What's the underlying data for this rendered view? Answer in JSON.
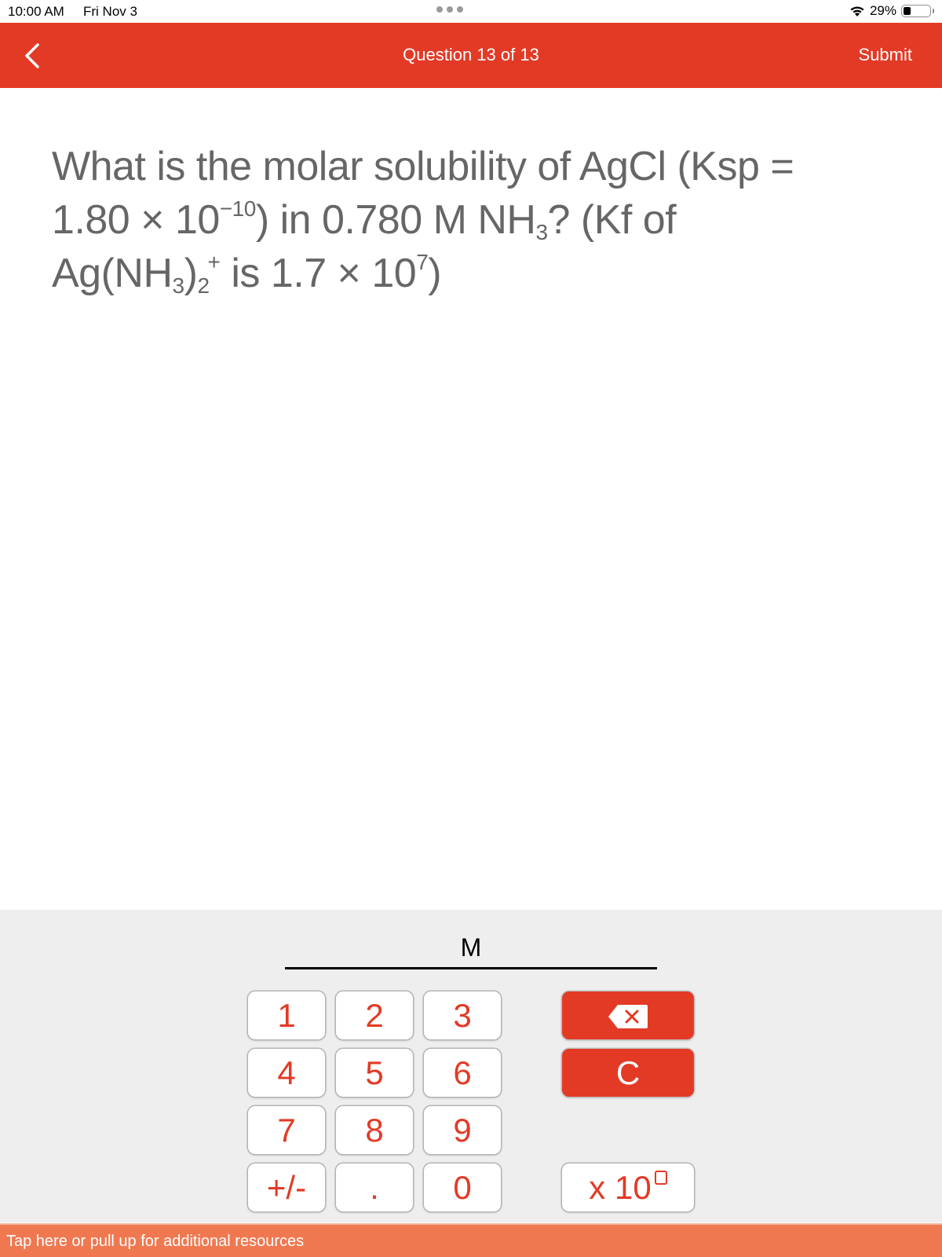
{
  "status_bar": {
    "time": "10:00 AM",
    "date": "Fri Nov 3",
    "battery_percent": "29%",
    "battery_level": 0.29,
    "icons": [
      "wifi-icon",
      "battery-icon",
      "multitask-dots-icon"
    ]
  },
  "nav": {
    "back_icon": "chevron-left-icon",
    "title": "Question 13 of 13",
    "submit_label": "Submit"
  },
  "question": {
    "line1": "What is the molar solubility of AgCl (Ksp =",
    "l2_a": "1.80 × 10",
    "l2_exp": "−10",
    "l2_b": ") in 0.780 M NH",
    "l2_sub": "3",
    "l2_c": "? (Kf of",
    "l3_a": "Ag(NH",
    "l3_sub1": "3",
    "l3_b": ")",
    "l3_sub2": "2",
    "l3_sup": "+",
    "l3_c": " is 1.7 × 10",
    "l3_exp": "7",
    "l3_d": ")"
  },
  "answer": {
    "value": "",
    "unit": "M"
  },
  "keypad": {
    "keys": [
      "1",
      "2",
      "3",
      "4",
      "5",
      "6",
      "7",
      "8",
      "9",
      "+/-",
      ".",
      "0"
    ],
    "backspace_icon": "backspace-icon",
    "clear_label": "C",
    "x10_label": "x 10"
  },
  "resources": {
    "label": "Tap here or pull up for additional resources"
  },
  "colors": {
    "accent": "#e33a26",
    "resources_bar": "#f07850",
    "keypad_bg": "#eeeeee",
    "question_text": "#666666"
  }
}
